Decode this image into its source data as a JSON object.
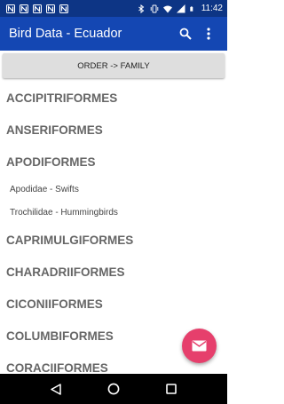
{
  "status_bar": {
    "time": "11:42",
    "icons": [
      "n-icon",
      "n-icon",
      "n-icon",
      "n-icon",
      "n-icon",
      "bluetooth-icon",
      "vibrate-icon",
      "wifi-icon",
      "signal-icon",
      "battery-icon"
    ]
  },
  "app_bar": {
    "title": "Bird Data - Ecuador",
    "actions": [
      "search-icon",
      "more-vert-icon"
    ]
  },
  "sort_button": {
    "label": "ORDER -> FAMILY"
  },
  "list": {
    "items": [
      {
        "kind": "order",
        "label": "ACCIPITRIFORMES"
      },
      {
        "kind": "order",
        "label": "ANSERIFORMES"
      },
      {
        "kind": "order",
        "label": "APODIFORMES"
      },
      {
        "kind": "family",
        "label": "Apodidae - Swifts"
      },
      {
        "kind": "family",
        "label": "Trochilidae - Hummingbirds"
      },
      {
        "kind": "order",
        "label": "CAPRIMULGIFORMES"
      },
      {
        "kind": "order",
        "label": "CHARADRIIFORMES"
      },
      {
        "kind": "order",
        "label": "CICONIIFORMES"
      },
      {
        "kind": "order",
        "label": "COLUMBIFORMES"
      },
      {
        "kind": "order",
        "label": "CORACIIFORMES"
      }
    ]
  },
  "fab": {
    "icon": "email-icon",
    "color": "#e63f6c"
  },
  "nav_bar": {
    "buttons": [
      "back-icon",
      "home-icon",
      "recents-icon"
    ]
  },
  "colors": {
    "status_bar": "#0d3585",
    "app_bar": "#1447b3",
    "sort_button": "#dedede"
  }
}
